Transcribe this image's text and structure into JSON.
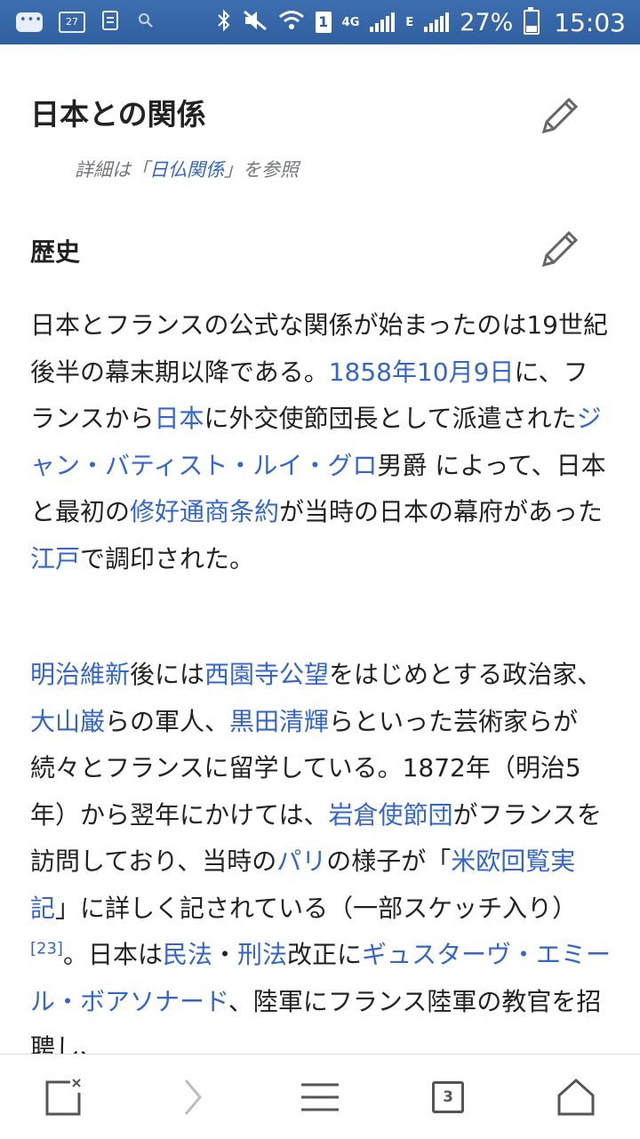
{
  "status_bar": {
    "calendar_day": "27",
    "sim_slot": "1",
    "network_type": "4G",
    "network_type_2": "E",
    "battery_percent": "27%",
    "time": "15:03",
    "icons": [
      "messenger-icon",
      "calendar-icon",
      "clipboard-icon",
      "search-icon",
      "bluetooth-icon",
      "mute-icon",
      "wifi-icon",
      "signal-icon",
      "battery-charging-icon"
    ]
  },
  "article": {
    "section_title": "日本との関係",
    "hatnote": {
      "prefix": "詳細は「",
      "link": "日仏関係",
      "suffix": "」を参照"
    },
    "subsection_title": "歴史",
    "paragraph1": [
      {
        "t": "日本とフランスの公式な関係が始まったのは19世紀後半の幕末期以降である。"
      },
      {
        "t": "1858年10月9日",
        "link": true
      },
      {
        "t": "に、フランスから"
      },
      {
        "t": "日本",
        "link": true
      },
      {
        "t": "に外交使節団長として派遣された"
      },
      {
        "t": "ジャン・バティスト・ルイ・グロ",
        "link": true
      },
      {
        "t": "男爵 によって、日本と最初の"
      },
      {
        "t": "修好通商条約",
        "link": true
      },
      {
        "t": "が当時の日本の幕府があった"
      },
      {
        "t": "江戸",
        "link": true
      },
      {
        "t": "で調印された。"
      }
    ],
    "paragraph2": [
      {
        "t": "明治維新",
        "link": true
      },
      {
        "t": "後には"
      },
      {
        "t": "西園寺公望",
        "link": true
      },
      {
        "t": "をはじめとする政治家、"
      },
      {
        "t": "大山巌",
        "link": true
      },
      {
        "t": "らの軍人、"
      },
      {
        "t": "黒田清輝",
        "link": true
      },
      {
        "t": "らといった芸術家らが続々とフランスに留学している。1872年（明治5年）から翌年にかけては、"
      },
      {
        "t": "岩倉使節団",
        "link": true
      },
      {
        "t": "がフランスを訪問しており、当時の"
      },
      {
        "t": "パリ",
        "link": true
      },
      {
        "t": "の様子が「"
      },
      {
        "t": "米欧回覧実記",
        "link": true
      },
      {
        "t": "」に詳しく記されている（一部スケッチ入り）"
      },
      {
        "t": "[23]",
        "link": true,
        "sup": true
      },
      {
        "t": "。日本は"
      },
      {
        "t": "民法",
        "link": true
      },
      {
        "t": "・"
      },
      {
        "t": "刑法",
        "link": true
      },
      {
        "t": "改正に"
      },
      {
        "t": "ギュスターヴ・エミール・ボアソナード",
        "link": true
      },
      {
        "t": "、陸軍にフランス陸軍の教官を招聘し、"
      }
    ]
  },
  "bottom_bar": {
    "tab_count": "3",
    "icons": [
      "close-page-icon",
      "forward-icon",
      "menu-icon",
      "tabs-icon",
      "home-icon"
    ]
  },
  "colors": {
    "status_bar": "#2f5f9f",
    "link": "#3366cc",
    "text": "#222222",
    "muted": "#72777d"
  }
}
